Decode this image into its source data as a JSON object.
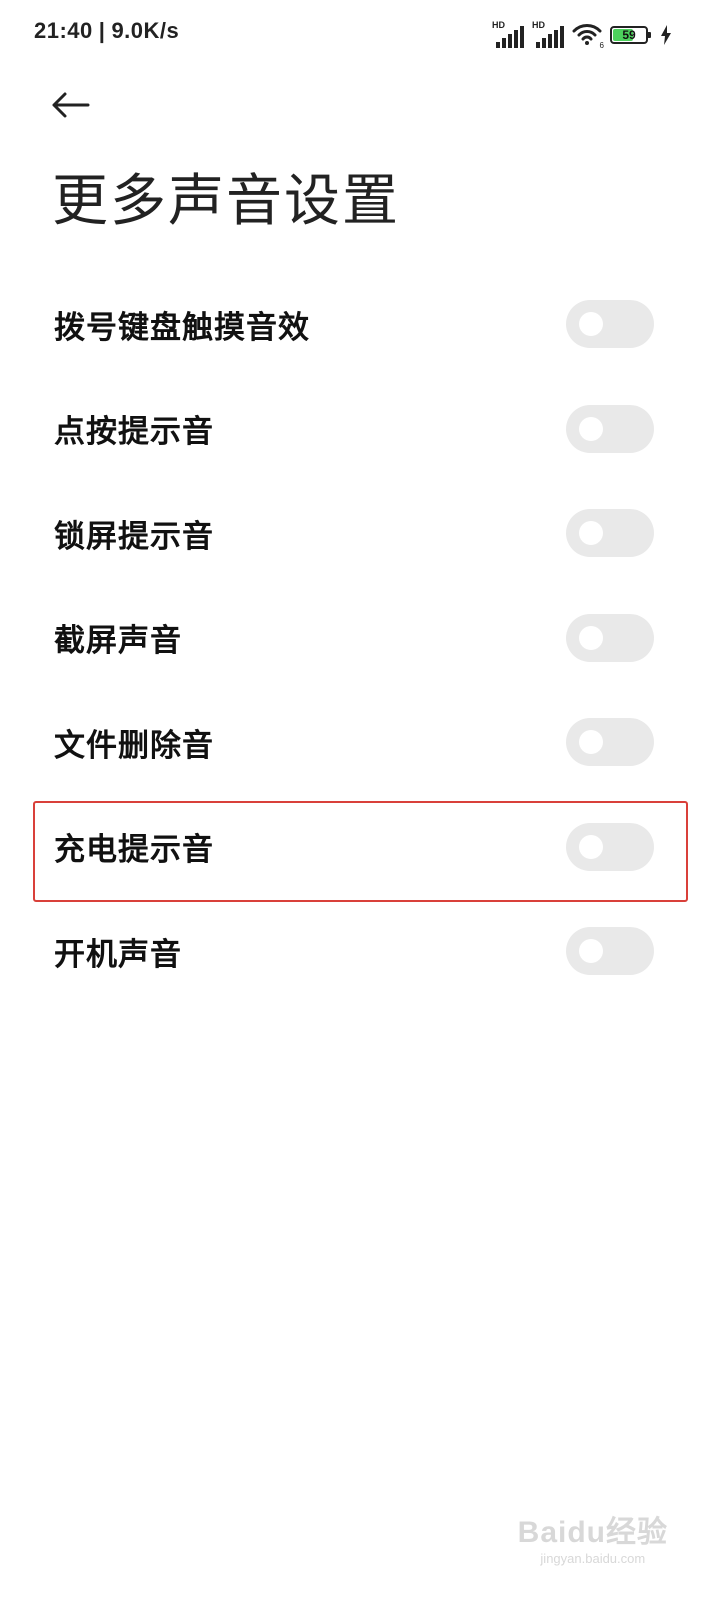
{
  "status_bar": {
    "time": "21:40",
    "separator": "|",
    "network_speed": "9.0K/s",
    "signal_label_1": "HD",
    "signal_label_2": "HD",
    "wifi_label": "6",
    "battery_level": "59",
    "battery_fraction": 0.59,
    "charging": true
  },
  "header": {
    "back_icon": "arrow-left-icon",
    "title": "更多声音设置"
  },
  "settings": [
    {
      "label": "拨号键盘触摸音效",
      "enabled": false
    },
    {
      "label": "点按提示音",
      "enabled": false
    },
    {
      "label": "锁屏提示音",
      "enabled": false
    },
    {
      "label": "截屏声音",
      "enabled": false
    },
    {
      "label": "文件删除音",
      "enabled": false
    },
    {
      "label": "充电提示音",
      "enabled": false,
      "highlighted": true
    },
    {
      "label": "开机声音",
      "enabled": false
    }
  ],
  "colors": {
    "toggle_off": "#e9e9e9",
    "highlight_border": "#d9403a",
    "battery_fill": "#4cd15c"
  },
  "watermark": {
    "main": "Baidu经验",
    "sub": "jingyan.baidu.com"
  }
}
